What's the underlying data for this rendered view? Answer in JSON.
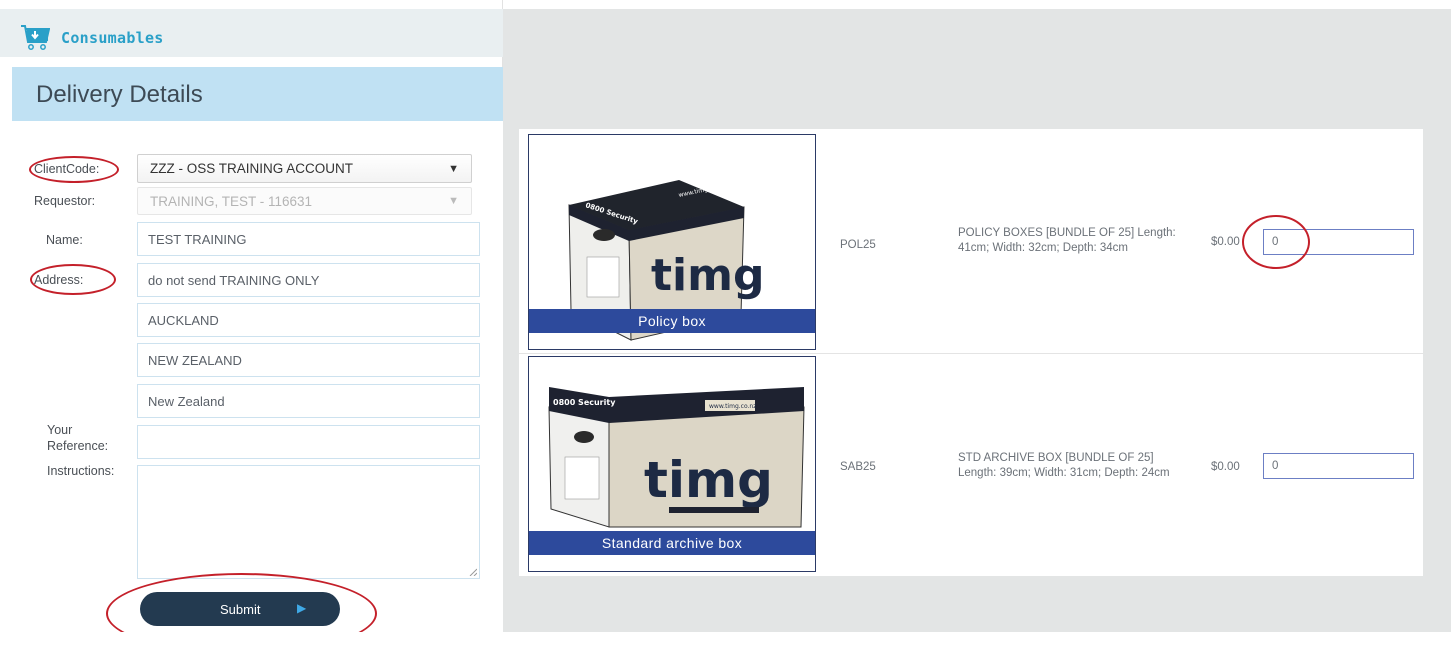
{
  "header": {
    "title": "Consumables",
    "icon": "cart-icon"
  },
  "delivery": {
    "title": "Delivery Details",
    "labels": {
      "client_code": "ClientCode:",
      "requestor": "Requestor:",
      "name": "Name:",
      "address": "Address:",
      "your_reference_1": "Your",
      "your_reference_2": "Reference:",
      "instructions": "Instructions:"
    },
    "client_code_value": "ZZZ - OSS TRAINING ACCOUNT",
    "requestor_value": "TRAINING, TEST - 116631",
    "name_value": "TEST TRAINING",
    "address_lines": [
      "do not send TRAINING ONLY",
      "AUCKLAND",
      "NEW ZEALAND",
      "New Zealand"
    ],
    "your_reference_value": "",
    "instructions_value": "",
    "submit_label": "Submit"
  },
  "products": [
    {
      "caption": "Policy box",
      "code": "POL25",
      "description": "POLICY BOXES [BUNDLE OF 25] Length: 41cm; Width: 32cm; Depth: 34cm",
      "price": "$0.00",
      "quantity": "0"
    },
    {
      "caption": "Standard archive box",
      "code": "SAB25",
      "description": "STD ARCHIVE BOX [BUNDLE OF 25] Length: 39cm; Width: 31cm; Depth: 24cm",
      "price": "$0.00",
      "quantity": "0"
    }
  ],
  "box_print": {
    "brand": "timg",
    "security": "0800 Security",
    "website": "www.timg.co.nz"
  },
  "colors": {
    "accent": "#2aa0c8",
    "banner": "#c0e1f3",
    "submit": "#233a50",
    "caption": "#2d4a9c",
    "annotation": "#c4202a"
  }
}
